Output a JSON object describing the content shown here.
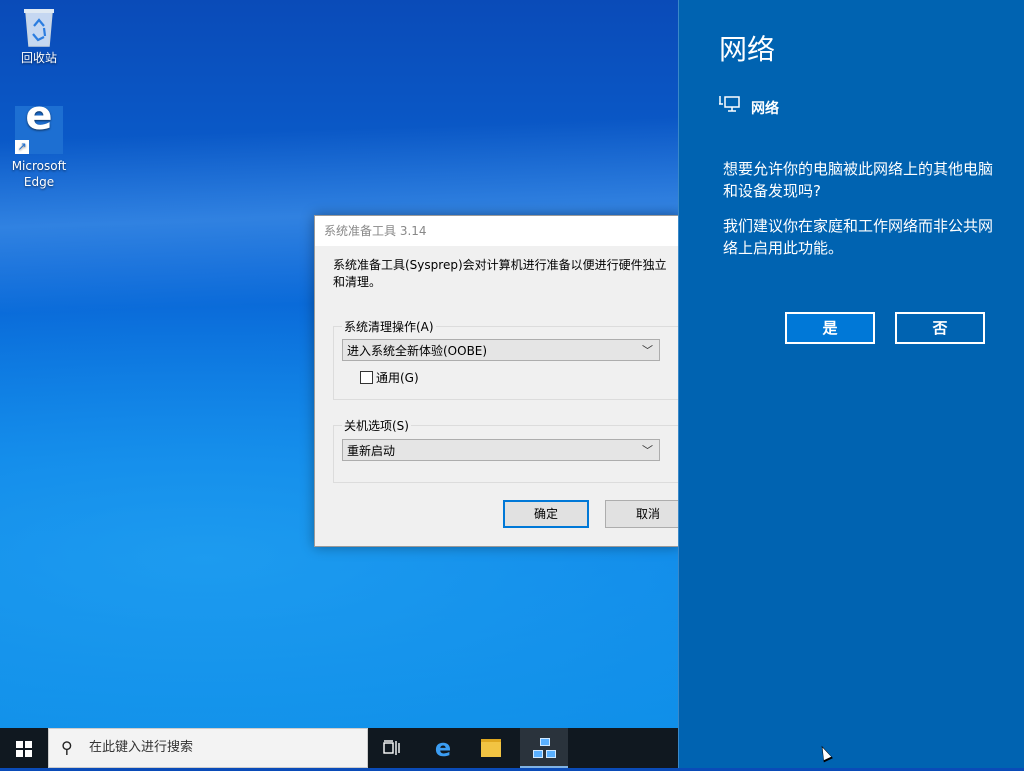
{
  "desktop": {
    "icons": [
      {
        "label": "回收站"
      },
      {
        "label": "Microsoft Edge",
        "line1": "Microsoft",
        "line2": "Edge"
      }
    ]
  },
  "sysprep": {
    "title": "系统准备工具 3.14",
    "description": "系统准备工具(Sysprep)会对计算机进行准备以便进行硬件独立和清理。",
    "cleanup_group_label": "系统清理操作(A)",
    "cleanup_selected": "进入系统全新体验(OOBE)",
    "generalize_label": "通用(G)",
    "generalize_checked": false,
    "shutdown_group_label": "关机选项(S)",
    "shutdown_selected": "重新启动",
    "ok_label": "确定",
    "cancel_label": "取消"
  },
  "network_flyout": {
    "title": "网络",
    "network_name": "网络",
    "prompt": "想要允许你的电脑被此网络上的其他电脑和设备发现吗?",
    "recommendation": "我们建议你在家庭和工作网络而非公共网络上启用此功能。",
    "yes_label": "是",
    "no_label": "否"
  },
  "taskbar": {
    "search_placeholder": "在此键入进行搜索",
    "icons": [
      "task-view-icon",
      "edge-icon",
      "file-explorer-icon",
      "network-wizard-icon"
    ]
  },
  "colors": {
    "flyout_bg": "#0063b1",
    "accent": "#0078d7",
    "taskbar_bg": "#101820"
  }
}
